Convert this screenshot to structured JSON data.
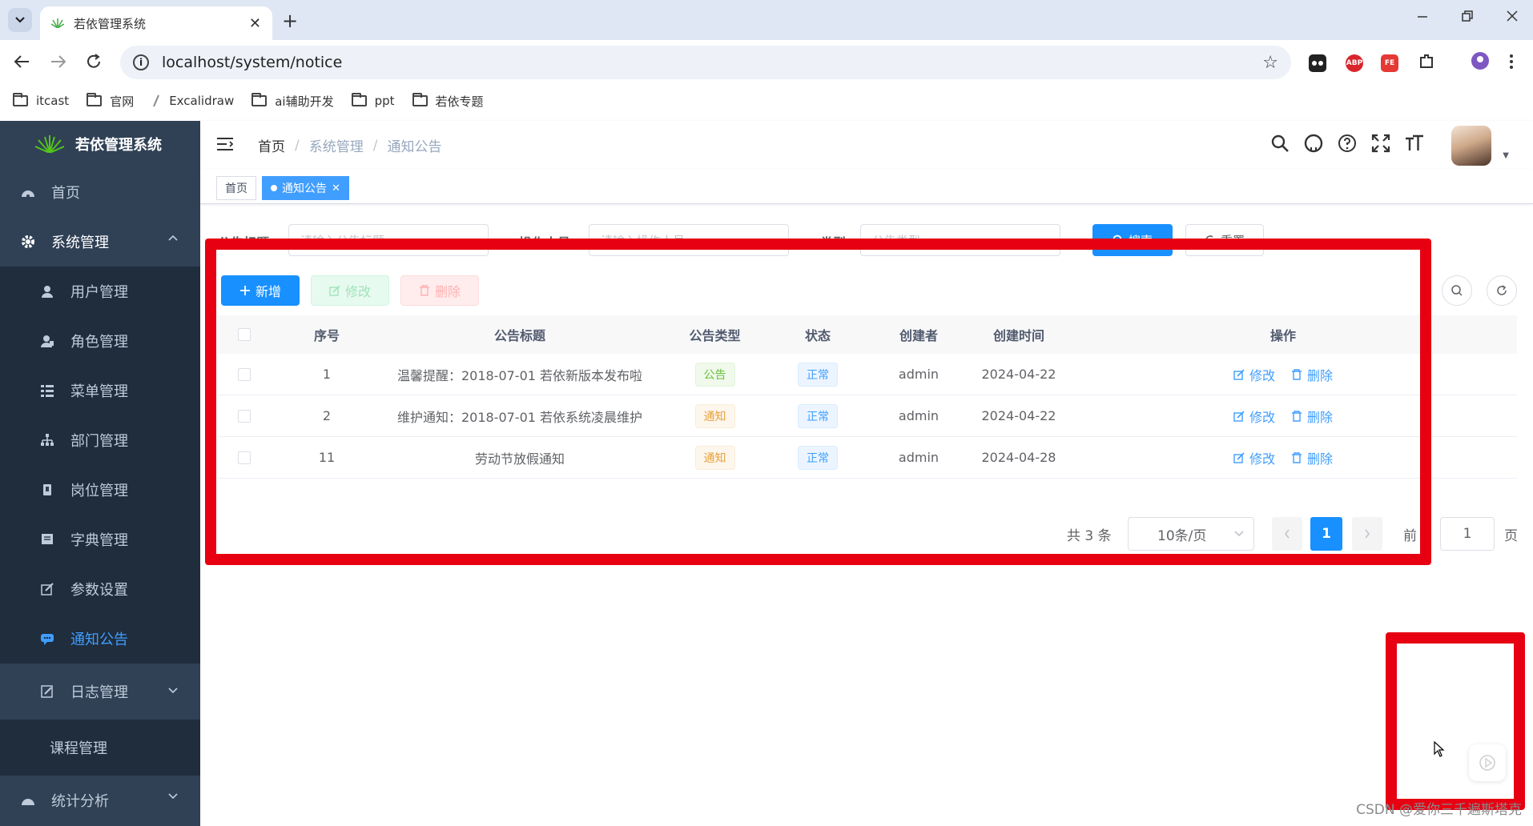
{
  "browser": {
    "tab_title": "若依管理系统",
    "url": "localhost/system/notice",
    "bookmarks": [
      "itcast",
      "官网",
      "Excalidraw",
      "ai辅助开发",
      "ppt",
      "若依专题"
    ],
    "extensions": [
      "ABP",
      "FE"
    ]
  },
  "sidebar": {
    "title": "若依管理系统",
    "home": "首页",
    "system": "系统管理",
    "items": [
      "用户管理",
      "角色管理",
      "菜单管理",
      "部门管理",
      "岗位管理",
      "字典管理",
      "参数设置",
      "通知公告",
      "日志管理"
    ],
    "course": "课程管理",
    "stats": "统计分析",
    "colors": {
      "bg": "#304156",
      "active": "#409eff"
    }
  },
  "navbar": {
    "breadcrumb": [
      "首页",
      "系统管理",
      "通知公告"
    ]
  },
  "tags": {
    "home": "首页",
    "current": "通知公告"
  },
  "search": {
    "title_label": "公告标题",
    "title_placeholder": "请输入公告标题",
    "operator_label": "操作人员",
    "operator_placeholder": "请输入操作人员",
    "type_label": "类型",
    "type_placeholder": "公告类型",
    "search_btn": "搜索",
    "reset_btn": "重置"
  },
  "toolbar": {
    "add": "新增",
    "edit": "修改",
    "delete": "删除"
  },
  "table": {
    "headers": [
      "序号",
      "公告标题",
      "公告类型",
      "状态",
      "创建者",
      "创建时间",
      "操作"
    ],
    "rows": [
      {
        "id": "1",
        "title": "温馨提醒：2018-07-01 若依新版本发布啦",
        "type": "公告",
        "status": "正常",
        "creator": "admin",
        "time": "2024-04-22"
      },
      {
        "id": "2",
        "title": "维护通知：2018-07-01 若依系统凌晨维护",
        "type": "通知",
        "status": "正常",
        "creator": "admin",
        "time": "2024-04-22"
      },
      {
        "id": "11",
        "title": "劳动节放假通知",
        "type": "通知",
        "status": "正常",
        "creator": "admin",
        "time": "2024-04-28"
      }
    ],
    "op_edit": "修改",
    "op_delete": "删除"
  },
  "pagination": {
    "total": "共 3 条",
    "page_size": "10条/页",
    "current": "1",
    "goto_prefix": "前",
    "goto_value": "1",
    "goto_suffix": "页"
  },
  "watermark": "CSDN @爱你三千遍斯塔克"
}
